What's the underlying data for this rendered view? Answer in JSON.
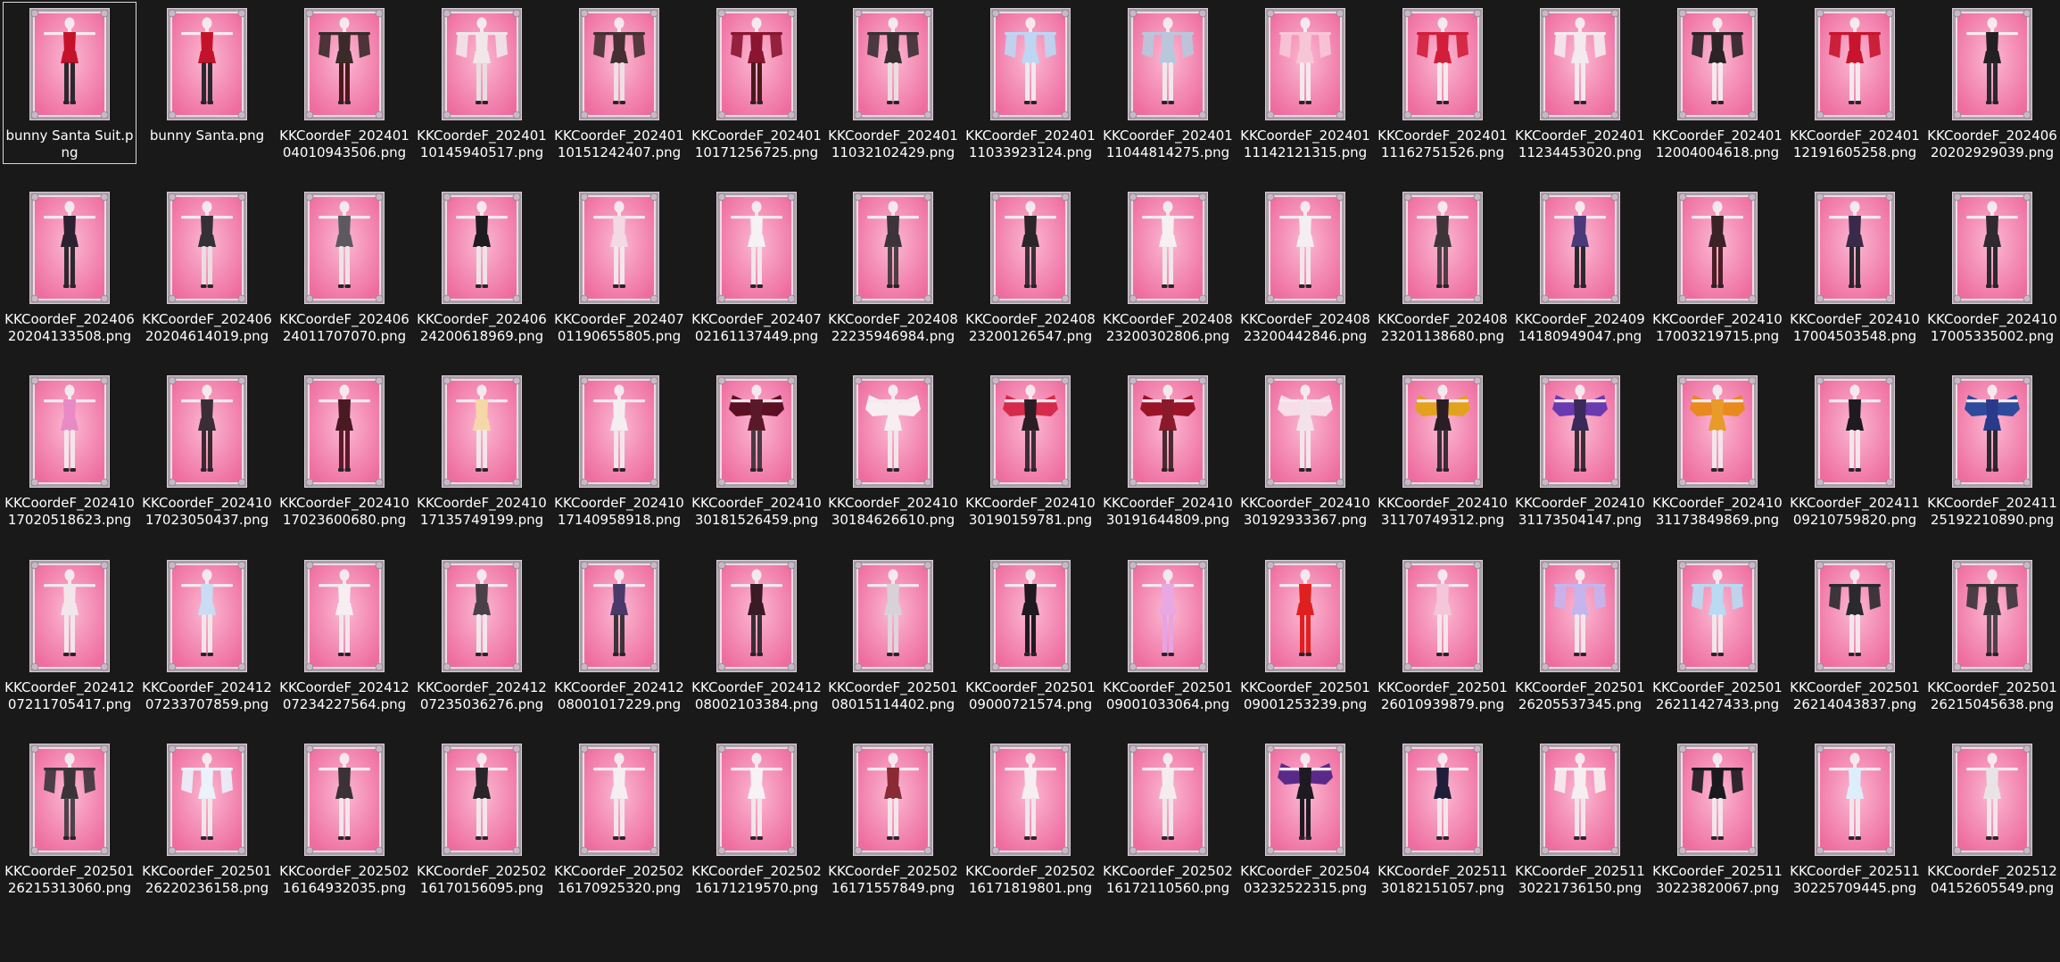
{
  "colors": {
    "background": "#191919",
    "card_pink": "#ee6d9f",
    "card_frame": "#a9a0a8",
    "selection_border": "#d9d9d9"
  },
  "icons": {
    "thumbnail": "character-card-thumbnail-icon"
  },
  "files": [
    {
      "name": "bunny Santa Suit.png",
      "outfit": "#c4122a",
      "legs": "#2a2a2e",
      "selected": true
    },
    {
      "name": "bunny Santa.png",
      "outfit": "#c4122a",
      "legs": "#2a2a2e"
    },
    {
      "name": "KKCoordeF_20240104010943506.png",
      "outfit": "#3a2a2a",
      "legs": "#4a1a1a",
      "sleeves": true
    },
    {
      "name": "KKCoordeF_20240110145940517.png",
      "outfit": "#f1e6ea",
      "legs": "#e9dde1",
      "sleeves": true
    },
    {
      "name": "KKCoordeF_20240110151242407.png",
      "outfit": "#443032",
      "legs": "#eedfe3",
      "sleeves": true
    },
    {
      "name": "KKCoordeF_20240110171256725.png",
      "outfit": "#8a1530",
      "legs": "#4a1a1a",
      "sleeves": true
    },
    {
      "name": "KKCoordeF_20240111032102429.png",
      "outfit": "#3a2f33",
      "legs": "#eadde1",
      "sleeves": true
    },
    {
      "name": "KKCoordeF_20240111033923124.png",
      "outfit": "#bcd6f3",
      "legs": "#f2e8ec",
      "sleeves": true
    },
    {
      "name": "KKCoordeF_20240111044814275.png",
      "outfit": "#b8c8dc",
      "legs": "#f2e8ec",
      "sleeves": true
    },
    {
      "name": "KKCoordeF_20240111142121315.png",
      "outfit": "#f7c6d6",
      "legs": "#f4e9ed",
      "sleeves": true
    },
    {
      "name": "KKCoordeF_20240111162751526.png",
      "outfit": "#d21e3a",
      "legs": "#f4e9ed",
      "sleeves": true
    },
    {
      "name": "KKCoordeF_20240111234453020.png",
      "outfit": "#f4eaee",
      "legs": "#f4e9ed",
      "sleeves": true
    },
    {
      "name": "KKCoordeF_20240112004004618.png",
      "outfit": "#2a2426",
      "legs": "#f4e9ed",
      "sleeves": true
    },
    {
      "name": "KKCoordeF_20240112191605258.png",
      "outfit": "#c8142c",
      "legs": "#f4e9ed",
      "sleeves": true
    },
    {
      "name": "KKCoordeF_20240620202929039.png",
      "outfit": "#232023",
      "legs": "#2a2a2e"
    },
    {
      "name": "KKCoordeF_20240620204133508.png",
      "outfit": "#2b2130",
      "legs": "#2a2a2e"
    },
    {
      "name": "KKCoordeF_20240620204614019.png",
      "outfit": "#353035",
      "legs": "#eadde1"
    },
    {
      "name": "KKCoordeF_20240624011707070.png",
      "outfit": "#5c5a60",
      "legs": "#efe3e7"
    },
    {
      "name": "KKCoordeF_20240624200618969.png",
      "outfit": "#1e1c1f",
      "legs": "#efe3e7"
    },
    {
      "name": "KKCoordeF_20240701190655805.png",
      "outfit": "#f3d9e2",
      "legs": "#f3e6eb"
    },
    {
      "name": "KKCoordeF_20240702161137449.png",
      "outfit": "#f6f1f3",
      "legs": "#f3e6eb"
    },
    {
      "name": "KKCoordeF_20240822235946984.png",
      "outfit": "#3b3438",
      "legs": "#4a4044"
    },
    {
      "name": "KKCoordeF_20240823200126547.png",
      "outfit": "#2a2528",
      "legs": "#3a3034"
    },
    {
      "name": "KKCoordeF_20240823200302806.png",
      "outfit": "#f6f0f3",
      "legs": "#f3e6eb"
    },
    {
      "name": "KKCoordeF_20240823200442846.png",
      "outfit": "#f5eef1",
      "legs": "#f3e6eb"
    },
    {
      "name": "KKCoordeF_20240823201138680.png",
      "outfit": "#3e3538",
      "legs": "#4a4044"
    },
    {
      "name": "KKCoordeF_20240914180949047.png",
      "outfit": "#4a3a7a",
      "legs": "#2a2a2e"
    },
    {
      "name": "KKCoordeF_20241017003219715.png",
      "outfit": "#3a2226",
      "legs": "#4a1e24"
    },
    {
      "name": "KKCoordeF_20241017004503548.png",
      "outfit": "#3a2a4a",
      "legs": "#2a2a2e"
    },
    {
      "name": "KKCoordeF_20241017005335002.png",
      "outfit": "#2f2a30",
      "legs": "#2a2a2e"
    },
    {
      "name": "KKCoordeF_20241017020518623.png",
      "outfit": "#e88ac4",
      "legs": "#f3e6eb"
    },
    {
      "name": "KKCoordeF_20241017023050437.png",
      "outfit": "#3a2e34",
      "legs": "#3a2a30"
    },
    {
      "name": "KKCoordeF_20241017023600680.png",
      "outfit": "#4a1a24",
      "legs": "#5a1a28"
    },
    {
      "name": "KKCoordeF_20241017135749199.png",
      "outfit": "#f6d8a8",
      "legs": "#f3e6eb"
    },
    {
      "name": "KKCoordeF_20241017140958918.png",
      "outfit": "#f4eef0",
      "legs": "#f3e6eb"
    },
    {
      "name": "KKCoordeF_20241030181526459.png",
      "outfit": "#5a1828",
      "legs": "#4a3a40",
      "wings": "#5a0f22"
    },
    {
      "name": "KKCoordeF_20241030184626610.png",
      "outfit": "#f6eef1",
      "legs": "#f3e6eb",
      "wings": "#f7eef2"
    },
    {
      "name": "KKCoordeF_20241030190159781.png",
      "outfit": "#2a1e24",
      "legs": "#3a2e34",
      "wings": "#d62a4a"
    },
    {
      "name": "KKCoordeF_20241030191644809.png",
      "outfit": "#8a1a2a",
      "legs": "#4a2a30",
      "wings": "#9a1428"
    },
    {
      "name": "KKCoordeF_20241030192933367.png",
      "outfit": "#f4e2ea",
      "legs": "#f3e6eb",
      "wings": "#f6dde8"
    },
    {
      "name": "KKCoordeF_20241031170749312.png",
      "outfit": "#2a1e24",
      "legs": "#3a2e34",
      "wings": "#e2a21e"
    },
    {
      "name": "KKCoordeF_20241031173504147.png",
      "outfit": "#3a2a5a",
      "legs": "#3a2e34",
      "wings": "#6a3ab0"
    },
    {
      "name": "KKCoordeF_20241031173849869.png",
      "outfit": "#e89a2a",
      "legs": "#f3e6eb",
      "wings": "#e88a1e"
    },
    {
      "name": "KKCoordeF_20241109210759820.png",
      "outfit": "#1e1a1e",
      "legs": "#f3e6eb"
    },
    {
      "name": "KKCoordeF_20241125192210890.png",
      "outfit": "#2a3a8a",
      "legs": "#2a2a2e",
      "wings": "#2e4a9a"
    },
    {
      "name": "KKCoordeF_20241207211705417.png",
      "outfit": "#f2e6ea",
      "legs": "#f3e6eb"
    },
    {
      "name": "KKCoordeF_20241207233707859.png",
      "outfit": "#c8dcf4",
      "legs": "#f3e6eb"
    },
    {
      "name": "KKCoordeF_20241207234227564.png",
      "outfit": "#f6eef1",
      "legs": "#f3e6eb"
    },
    {
      "name": "KKCoordeF_20241207235036276.png",
      "outfit": "#4a4048",
      "legs": "#f3e6eb"
    },
    {
      "name": "KKCoordeF_20241208001017229.png",
      "outfit": "#4a3a6a",
      "legs": "#3a3438"
    },
    {
      "name": "KKCoordeF_20241208002103384.png",
      "outfit": "#3a1a24",
      "legs": "#3a2e34"
    },
    {
      "name": "KKCoordeF_20250108015114402.png",
      "outfit": "#d8d2d6",
      "legs": "#ded6da"
    },
    {
      "name": "KKCoordeF_20250109000721574.png",
      "outfit": "#1e1a1e",
      "legs": "#1e1a1e"
    },
    {
      "name": "KKCoordeF_20250109001033064.png",
      "outfit": "#e8a8e4",
      "legs": "#e6a4e2"
    },
    {
      "name": "KKCoordeF_20250109001253239.png",
      "outfit": "#e0201e",
      "legs": "#e0201e"
    },
    {
      "name": "KKCoordeF_20250126010939879.png",
      "outfit": "#f4c6d8",
      "legs": "#f3e6eb"
    },
    {
      "name": "KKCoordeF_20250126205537345.png",
      "outfit": "#c6b4ee",
      "legs": "#f3e6eb",
      "sleeves": true
    },
    {
      "name": "KKCoordeF_20250126211427433.png",
      "outfit": "#b8daf2",
      "legs": "#f3e6eb",
      "sleeves": true
    },
    {
      "name": "KKCoordeF_20250126214043837.png",
      "outfit": "#2a2a2e",
      "legs": "#f3e6eb",
      "sleeves": true
    },
    {
      "name": "KKCoordeF_20250126215045638.png",
      "outfit": "#3a3438",
      "legs": "#4a4448",
      "sleeves": true
    },
    {
      "name": "KKCoordeF_20250126215313060.png",
      "outfit": "#3a3438",
      "legs": "#4a4448",
      "sleeves": true
    },
    {
      "name": "KKCoordeF_20250126220236158.png",
      "outfit": "#eaf2fb",
      "legs": "#f3e6eb",
      "sleeves": true
    },
    {
      "name": "KKCoordeF_20250216164932035.png",
      "outfit": "#3a3236",
      "legs": "#f3e6eb"
    },
    {
      "name": "KKCoordeF_20250216170156095.png",
      "outfit": "#2a2528",
      "legs": "#f3e6eb"
    },
    {
      "name": "KKCoordeF_20250216170925320.png",
      "outfit": "#f6eef1",
      "legs": "#f3e6eb"
    },
    {
      "name": "KKCoordeF_20250216171219570.png",
      "outfit": "#f8f2f4",
      "legs": "#f3e6eb"
    },
    {
      "name": "KKCoordeF_20250216171557849.png",
      "outfit": "#8a2a34",
      "legs": "#f3e6eb"
    },
    {
      "name": "KKCoordeF_20250216171819801.png",
      "outfit": "#f6eef1",
      "legs": "#f3e6eb"
    },
    {
      "name": "KKCoordeF_20250216172110560.png",
      "outfit": "#f4ecef",
      "legs": "#f3e6eb"
    },
    {
      "name": "KKCoordeF_20250403232522315.png",
      "outfit": "#1e1a22",
      "legs": "#1e1a22",
      "wings": "#5a2a8a"
    },
    {
      "name": "KKCoordeF_20251130182151057.png",
      "outfit": "#1e1e3a",
      "legs": "#f3e6eb"
    },
    {
      "name": "KKCoordeF_20251130221736150.png",
      "outfit": "#f6eef1",
      "legs": "#f3e6eb",
      "sleeves": true
    },
    {
      "name": "KKCoordeF_20251130223820067.png",
      "outfit": "#1a1a1e",
      "legs": "#f3e6eb",
      "sleeves": true
    },
    {
      "name": "KKCoordeF_20251130225709445.png",
      "outfit": "#dceefa",
      "legs": "#f3e6eb"
    },
    {
      "name": "KKCoordeF_20251204152605549.png",
      "outfit": "#e8e4e6",
      "legs": "#f3e6eb"
    }
  ]
}
